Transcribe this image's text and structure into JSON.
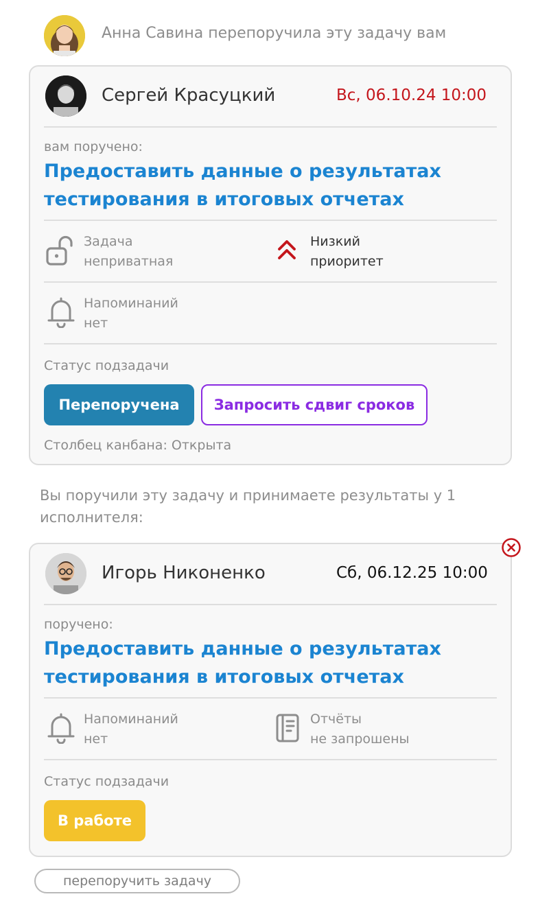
{
  "header": {
    "reassign_text": "Анна Савина перепоручила эту задачу вам"
  },
  "card1": {
    "person_name": "Сергей Красуцкий",
    "date": "Вс, 06.10.24 10:00",
    "date_color": "#c4161c",
    "assigned_label": "вам поручено:",
    "task_title_line1": "Предоставить данные о результатах",
    "task_title_line2": "тестирования в итоговых отчетах",
    "privacy_line1": "Задача",
    "privacy_line2": "неприватная",
    "priority_line1": "Низкий",
    "priority_line2": "приоритет",
    "reminders_line1": "Напоминаний",
    "reminders_line2": "нет",
    "status_label": "Статус подзадачи",
    "status_button": "Перепоручена",
    "request_button": "Запросить сдвиг сроков",
    "kanban_text": "Столбец канбана: Открыта"
  },
  "info_text_line1": "Вы поручили эту задачу и принимаете результаты у 1",
  "info_text_line2": "исполнителя:",
  "card2": {
    "person_name": "Игорь Никоненко",
    "date": "Сб, 06.12.25 10:00",
    "assigned_label": "поручено:",
    "task_title_line1": "Предоставить данные о результатах",
    "task_title_line2": "тестирования в итоговых отчетах",
    "reminders_line1": "Напоминаний",
    "reminders_line2": "нет",
    "reports_line1": "Отчёты",
    "reports_line2": "не запрошены",
    "status_label": "Статус подзадачи",
    "status_button": "В работе"
  },
  "reassign_link": "перепоручить задачу",
  "colors": {
    "accent_blue": "#1b84d1",
    "status_reassigned": "#2382b0",
    "request_purple": "#8a2be2",
    "status_in_progress": "#f3c22b",
    "priority_red": "#c4161c"
  }
}
